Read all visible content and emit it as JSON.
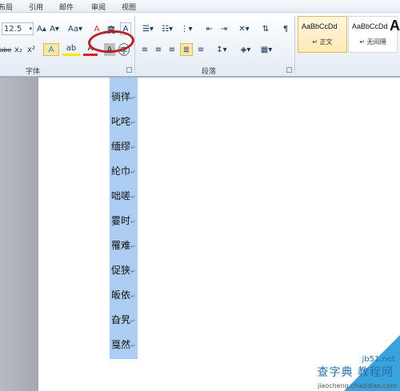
{
  "menu": {
    "items": [
      "布局",
      "引用",
      "邮件",
      "审阅",
      "视图"
    ]
  },
  "font_group": {
    "label": "字体",
    "size_value": "12.5",
    "grow_icon": "A▴",
    "shrink_icon": "A▾",
    "change_case": "Aa▾",
    "erase_format": "A",
    "phonetic_guide": "变",
    "char_border": "A",
    "strike": "abe",
    "subscript": "x₂",
    "superscript": "x²",
    "text_effect": "A",
    "highlight": "ab",
    "font_color": "A",
    "char_shading": "A",
    "enclose_char": "字"
  },
  "paragraph_group": {
    "label": "段落"
  },
  "styles_group": {
    "tiles": [
      {
        "sample": "AaBbCcDd",
        "name": "↵ 正文",
        "selected": true
      },
      {
        "sample": "AaBbCcDd",
        "name": "↵ 无间隔",
        "selected": false
      },
      {
        "sample": "A",
        "name": "",
        "selected": false
      }
    ]
  },
  "document": {
    "lines": [
      "徜徉",
      "叱咤",
      "缅缪",
      "纶巾",
      "咄嗟",
      "霎时",
      "罹难",
      "促狭",
      "皈依",
      "旮旯",
      "戛然"
    ],
    "paragraph_mark": "↵"
  },
  "watermark": {
    "site": "jb51.net",
    "title": "查字典 教程网",
    "url": "jiaocheng.chazidian.com"
  },
  "colors": {
    "highlight": "#aecdf3",
    "annotation": "#b3232a",
    "ribbon_bg": "#e3ebf5"
  }
}
